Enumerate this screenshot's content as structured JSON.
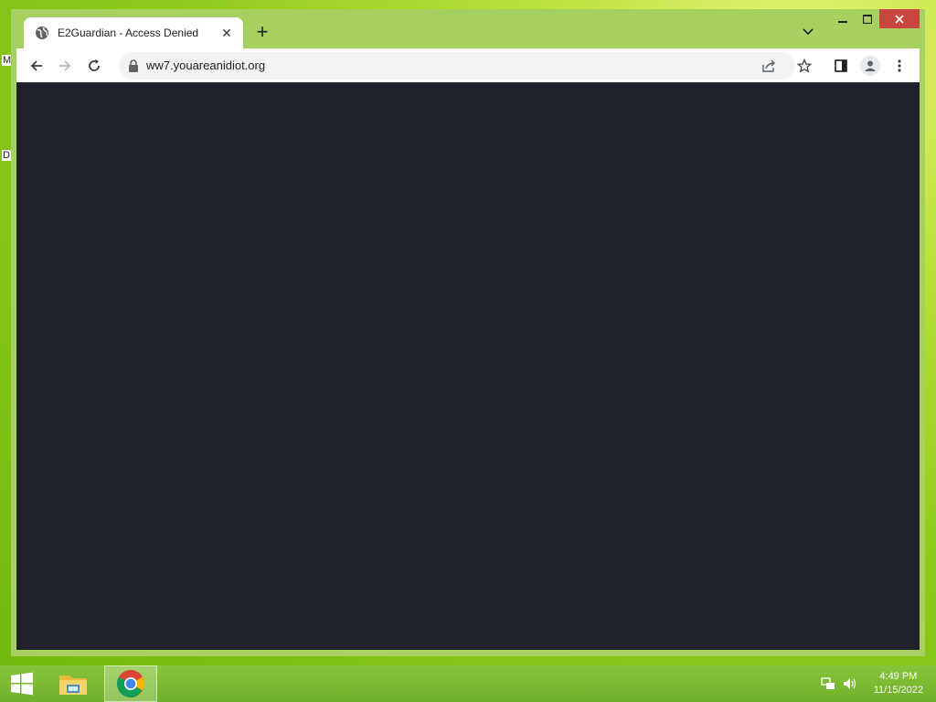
{
  "desktop": {
    "fragment_1": "M",
    "fragment_2": "D"
  },
  "browser": {
    "tab": {
      "title": "E2Guardian - Access Denied",
      "favicon": "globe-icon",
      "close_icon": "close-icon"
    },
    "new_tab_label": "+",
    "toolbar": {
      "url": "ww7.youareanidiot.org",
      "icons": [
        "back-icon",
        "forward-icon",
        "reload-icon",
        "lock-icon",
        "share-icon",
        "star-icon",
        "side-panel-icon",
        "profile-icon",
        "menu-icon"
      ]
    },
    "content": {
      "background": "#1f222b"
    }
  },
  "taskbar": {
    "clock_time": "4:49 PM",
    "clock_date": "11/15/2022",
    "apps": [
      "start-icon",
      "file-explorer-icon",
      "chrome-icon"
    ]
  },
  "colors": {
    "close_button": "#c7463e",
    "frame": "#a6d05f"
  }
}
